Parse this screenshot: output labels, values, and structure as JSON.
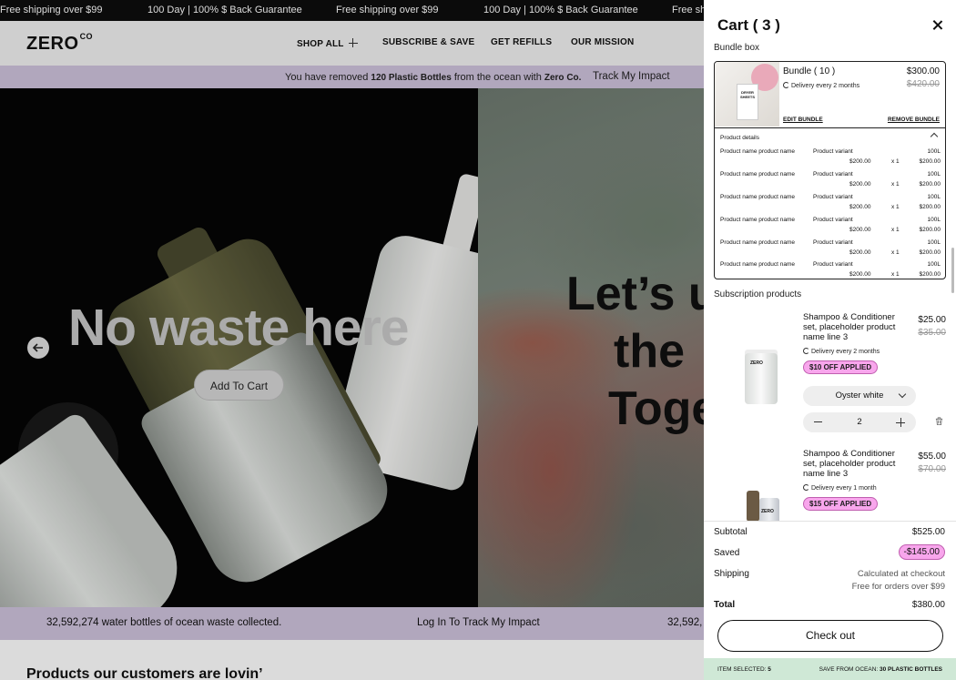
{
  "ticker": {
    "items": [
      "Free shipping over $99",
      "100 Day | 100% $ Back Guarantee",
      "Free shipping over $99",
      "100 Day | 100% $ Back Guarantee",
      "Free sh"
    ]
  },
  "nav": {
    "logo": "ZERO",
    "logo_sup": "CO",
    "links": [
      "SHOP ALL",
      "SUBSCRIBE & SAVE",
      "GET REFILLS",
      "OUR MISSION"
    ]
  },
  "impact": {
    "prefix": "You have removed ",
    "count": "120 Plastic Bottles",
    "middle": " from the ocean with ",
    "brand": "Zero Co.",
    "link": "Track My Impact"
  },
  "hero": {
    "title": "No waste here",
    "add_to_cart": "Add To Cart",
    "right_title_lines": [
      "Let’s u",
      "the",
      "Toge"
    ]
  },
  "stats": {
    "left": "32,592,274 water bottles of ocean waste collected.",
    "center": "Log In To Track My Impact",
    "right": "32,592,"
  },
  "products_heading": "Products our customers are lovin’",
  "cart": {
    "title": "Cart ( 3 )",
    "bundle_label": "Bundle box",
    "bundle": {
      "image_text": "DRYER SHEETS",
      "name": "Bundle ( 10 )",
      "price": "$300.00",
      "old_price": "$420.00",
      "delivery": "Delivery every 2 months",
      "edit": "EDIT BUNDLE",
      "remove": "REMOVE BUNDLE",
      "details_title": "Product details",
      "rows": [
        {
          "name": "Product name product name",
          "variant": "Product variant",
          "size": "100L",
          "price": "$200.00",
          "qty": "x 1",
          "total": "$200.00"
        },
        {
          "name": "Product name product name",
          "variant": "Product variant",
          "size": "100L",
          "price": "$200.00",
          "qty": "x 1",
          "total": "$200.00"
        },
        {
          "name": "Product name product name",
          "variant": "Product variant",
          "size": "100L",
          "price": "$200.00",
          "qty": "x 1",
          "total": "$200.00"
        },
        {
          "name": "Product name product name",
          "variant": "Product variant",
          "size": "100L",
          "price": "$200.00",
          "qty": "x 1",
          "total": "$200.00"
        },
        {
          "name": "Product name product name",
          "variant": "Product variant",
          "size": "100L",
          "price": "$200.00",
          "qty": "x 1",
          "total": "$200.00"
        },
        {
          "name": "Product name product name",
          "variant": "Product variant",
          "size": "100L",
          "price": "$200.00",
          "qty": "x 1",
          "total": "$200.00"
        }
      ]
    },
    "subscription_label": "Subscription products",
    "items": [
      {
        "jar_label": "ZERO",
        "name": "Shampoo & Conditioner set, placeholder product name line 3",
        "price": "$25.00",
        "old_price": "$35.00",
        "delivery": "Delivery every 2 months",
        "badge": "$10 OFF APPLIED",
        "variant": "Oyster white",
        "qty": "2"
      },
      {
        "jar_label": "ZERO",
        "name": "Shampoo & Conditioner set, placeholder product name line 3",
        "price": "$55.00",
        "old_price": "$70.00",
        "delivery": "Delivery every 1 month",
        "badge": "$15 OFF APPLIED"
      }
    ],
    "summary": {
      "subtotal_label": "Subtotal",
      "subtotal": "$525.00",
      "saved_label": "Saved",
      "saved": "-$145.00",
      "shipping_label": "Shipping",
      "shipping_value": "Calculated at checkout",
      "shipping_note": "Free for orders over $99",
      "total_label": "Total",
      "total": "$380.00",
      "checkout": "Check out"
    },
    "footer": {
      "items_label": "ITEM SELECTED: ",
      "items_count": "5",
      "save_label": "SAVE FROM OCEAN: ",
      "save_value": "30 PLASTIC BOTTLES"
    }
  }
}
